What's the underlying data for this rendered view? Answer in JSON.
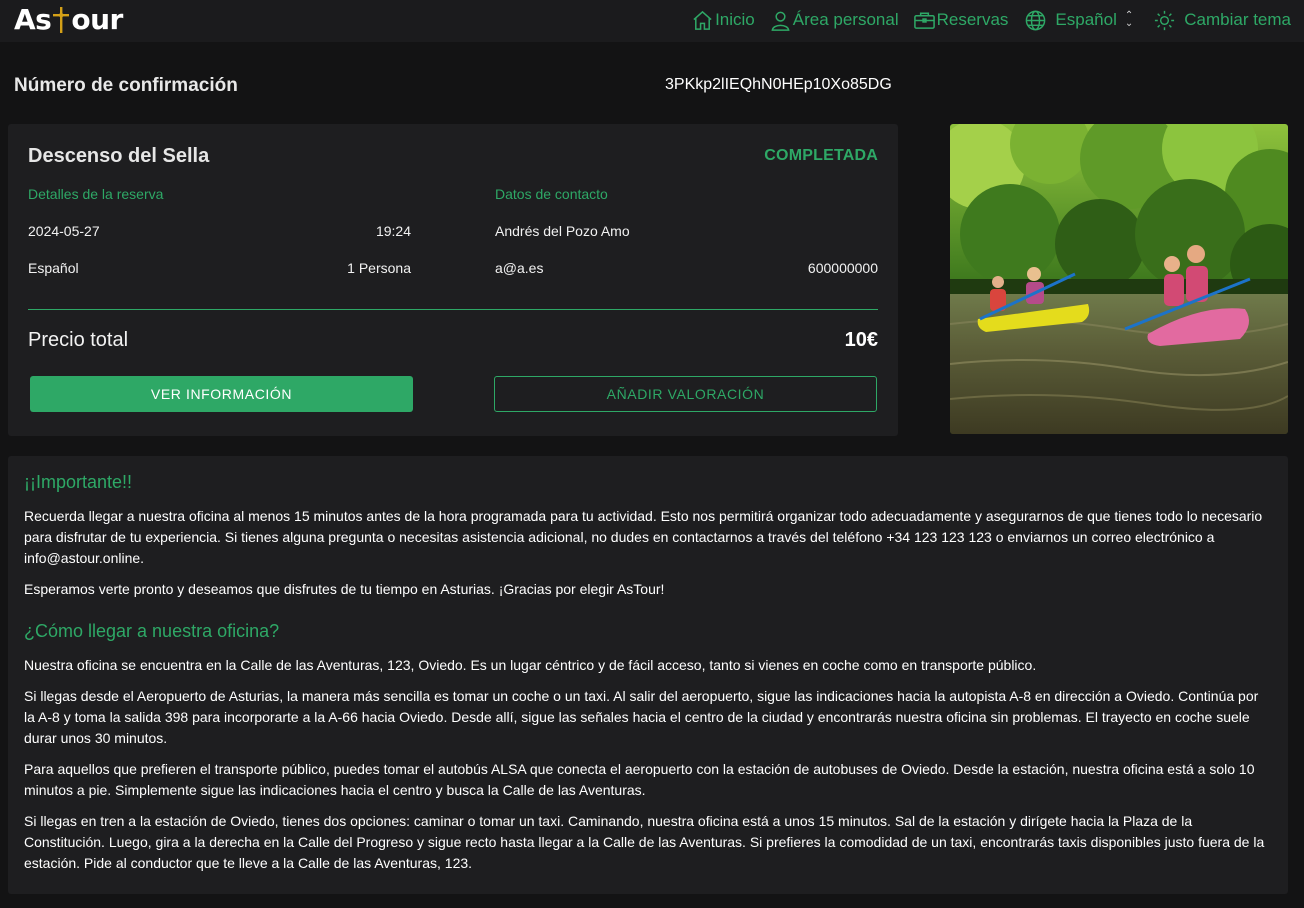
{
  "header": {
    "logo": {
      "left": "As",
      "right": "our"
    },
    "nav": [
      {
        "label": "Inicio",
        "icon": "home-icon"
      },
      {
        "label": "Área personal",
        "icon": "user-icon"
      },
      {
        "label": "Reservas",
        "icon": "briefcase-icon"
      },
      {
        "label": "Español",
        "icon": "globe-icon"
      },
      {
        "label": "Cambiar tema",
        "icon": "sun-icon"
      }
    ]
  },
  "confirmation": {
    "label": "Número de confirmación",
    "code": "3PKkp2lIEQhN0HEp10Xo85DG"
  },
  "booking": {
    "title": "Descenso del Sella",
    "status": "COMPLETADA",
    "details_heading": "Detalles de la reserva",
    "contact_heading": "Datos de contacto",
    "date": "2024-05-27",
    "time": "19:24",
    "language": "Español",
    "people": "1 Persona",
    "contact_name": "Andrés del Pozo Amo",
    "contact_email": "a@a.es",
    "contact_phone": "600000000",
    "total_label": "Precio total",
    "total_value": "10€",
    "btn_info": "VER INFORMACIÓN",
    "btn_rate": "AÑADIR VALORACIÓN"
  },
  "info": {
    "important_title": "¡¡Importante!!",
    "important_p1": "Recuerda llegar a nuestra oficina al menos 15 minutos antes de la hora programada para tu actividad. Esto nos permitirá organizar todo adecuadamente y asegurarnos de que tienes todo lo necesario para disfrutar de tu experiencia. Si tienes alguna pregunta o necesitas asistencia adicional, no dudes en contactarnos a través del teléfono +34 123 123 123 o enviarnos un correo electrónico a info@astour.online.",
    "important_p2": "Esperamos verte pronto y deseamos que disfrutes de tu tiempo en Asturias. ¡Gracias por elegir AsTour!",
    "howto_title": "¿Cómo llegar a nuestra oficina?",
    "howto_p1": "Nuestra oficina se encuentra en la Calle de las Aventuras, 123, Oviedo. Es un lugar céntrico y de fácil acceso, tanto si vienes en coche como en transporte público.",
    "howto_p2": "Si llegas desde el Aeropuerto de Asturias, la manera más sencilla es tomar un coche o un taxi. Al salir del aeropuerto, sigue las indicaciones hacia la autopista A-8 en dirección a Oviedo. Continúa por la A-8 y toma la salida 398 para incorporarte a la A-66 hacia Oviedo. Desde allí, sigue las señales hacia el centro de la ciudad y encontrarás nuestra oficina sin problemas. El trayecto en coche suele durar unos 30 minutos.",
    "howto_p3": "Para aquellos que prefieren el transporte público, puedes tomar el autobús ALSA que conecta el aeropuerto con la estación de autobuses de Oviedo. Desde la estación, nuestra oficina está a solo 10 minutos a pie. Simplemente sigue las indicaciones hacia el centro y busca la Calle de las Aventuras.",
    "howto_p4": "Si llegas en tren a la estación de Oviedo, tienes dos opciones: caminar o tomar un taxi. Caminando, nuestra oficina está a unos 15 minutos. Sal de la estación y dirígete hacia la Plaza de la Constitución. Luego, gira a la derecha en la Calle del Progreso y sigue recto hasta llegar a la Calle de las Aventuras. Si prefieres la comodidad de un taxi, encontrarás taxis disponibles justo fuera de la estación. Pide al conductor que te lleve a la Calle de las Aventuras, 123."
  },
  "colors": {
    "accent": "#2ea866",
    "background": "#131314",
    "panel": "#1e1e20",
    "logo_cross": "#d4a017"
  }
}
